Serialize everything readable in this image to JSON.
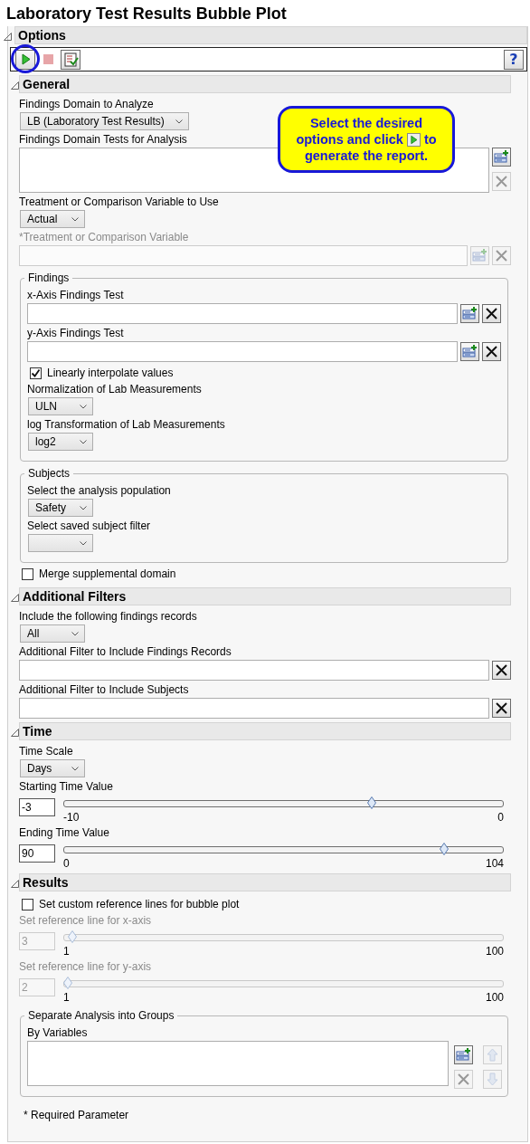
{
  "title": "Laboratory Test Results Bubble Plot",
  "options": {
    "title": "Options",
    "expanded": true,
    "toolbar": [
      {
        "kind": "run",
        "disabled": false,
        "circled": true
      },
      {
        "kind": "stop",
        "disabled": true
      },
      {
        "kind": "checklist",
        "disabled": false
      },
      {
        "kind": "help",
        "label": "?",
        "disabled": false
      }
    ],
    "callout": {
      "text_before": "Select the desired options and click",
      "text_after": "to generate the report."
    },
    "sections": [
      {
        "title": "General",
        "expanded": true,
        "items": [
          {
            "kind": "label",
            "text": "Findings Domain to Analyze"
          },
          {
            "kind": "select",
            "value": "LB (Laboratory Test Results)"
          },
          {
            "kind": "label",
            "text": "Findings Domain Tests for Analysis"
          },
          {
            "kind": "list",
            "tools": [
              {
                "kind": "add",
                "disabled": false
              },
              {
                "kind": "remove",
                "disabled": true
              }
            ]
          },
          {
            "kind": "label",
            "text": "Treatment or Comparison Variable to Use"
          },
          {
            "kind": "select",
            "value": "Actual"
          },
          {
            "kind": "label",
            "text": "*Treatment or Comparison Variable",
            "disabled": true
          },
          {
            "kind": "field",
            "disabled": true,
            "tools": [
              {
                "kind": "add",
                "disabled": true
              },
              {
                "kind": "remove",
                "disabled": true
              }
            ]
          },
          {
            "kind": "group",
            "title": "Findings",
            "items": [
              {
                "kind": "label",
                "text": "x-Axis Findings Test"
              },
              {
                "kind": "field",
                "tools": [
                  {
                    "kind": "add",
                    "disabled": false
                  },
                  {
                    "kind": "remove",
                    "disabled": false
                  }
                ]
              },
              {
                "kind": "label",
                "text": "y-Axis Findings Test"
              },
              {
                "kind": "field",
                "tools": [
                  {
                    "kind": "add",
                    "disabled": false
                  },
                  {
                    "kind": "remove",
                    "disabled": false
                  }
                ]
              },
              {
                "kind": "checkbox",
                "label": "Linearly interpolate values",
                "checked": true
              },
              {
                "kind": "label",
                "text": "Normalization of Lab Measurements"
              },
              {
                "kind": "select",
                "value": "ULN"
              },
              {
                "kind": "label",
                "text": "log Transformation of Lab Measurements"
              },
              {
                "kind": "select",
                "value": "log2"
              }
            ]
          },
          {
            "kind": "group",
            "title": "Subjects",
            "items": [
              {
                "kind": "label",
                "text": "Select the analysis population"
              },
              {
                "kind": "select",
                "value": "Safety"
              },
              {
                "kind": "label",
                "text": "Select saved subject filter"
              },
              {
                "kind": "select"
              }
            ]
          },
          {
            "kind": "checkbox",
            "label": "Merge supplemental domain",
            "checked": false
          }
        ]
      },
      {
        "title": "Additional Filters",
        "expanded": true,
        "items": [
          {
            "kind": "label",
            "text": "Include the following findings records"
          },
          {
            "kind": "select",
            "value": "All"
          },
          {
            "kind": "label",
            "text": "Additional Filter to Include Findings Records"
          },
          {
            "kind": "field",
            "tools": [
              {
                "kind": "remove",
                "disabled": false
              }
            ]
          },
          {
            "kind": "label",
            "text": "Additional Filter to Include Subjects"
          },
          {
            "kind": "field",
            "tools": [
              {
                "kind": "remove",
                "disabled": false
              }
            ]
          }
        ]
      },
      {
        "title": "Time",
        "expanded": true,
        "items": [
          {
            "kind": "label",
            "text": "Time Scale"
          },
          {
            "kind": "select",
            "value": "Days"
          },
          {
            "kind": "label",
            "text": "Starting Time Value"
          },
          {
            "kind": "slider",
            "value": "-3",
            "min": "-10",
            "max": "0",
            "level": 0.7,
            "disabled": false
          },
          {
            "kind": "label",
            "text": "Ending Time Value"
          },
          {
            "kind": "slider",
            "value": "90",
            "min": "0",
            "max": "104",
            "level": 0.865,
            "disabled": false
          }
        ]
      },
      {
        "title": "Results",
        "expanded": true,
        "items": [
          {
            "kind": "checkbox",
            "label": "Set custom reference lines for bubble plot",
            "checked": false
          },
          {
            "kind": "label",
            "text": "Set reference line for x-axis",
            "disabled": true
          },
          {
            "kind": "slider",
            "value": "3",
            "min": "1",
            "max": "100",
            "level": 0.02,
            "disabled": true
          },
          {
            "kind": "label",
            "text": "Set reference line for y-axis",
            "disabled": true
          },
          {
            "kind": "slider",
            "value": "2",
            "min": "1",
            "max": "100",
            "level": 0.01,
            "disabled": true
          },
          {
            "kind": "group",
            "title": "Separate Analysis into Groups",
            "items": [
              {
                "kind": "label",
                "text": "By Variables"
              },
              {
                "kind": "list",
                "tools": [
                  {
                    "kind": "add",
                    "disabled": false
                  },
                  {
                    "kind": "up",
                    "disabled": true
                  },
                  {
                    "kind": "remove",
                    "disabled": true
                  },
                  {
                    "kind": "down",
                    "disabled": true
                  }
                ]
              }
            ]
          }
        ]
      }
    ],
    "footnote": "* Required Parameter"
  }
}
